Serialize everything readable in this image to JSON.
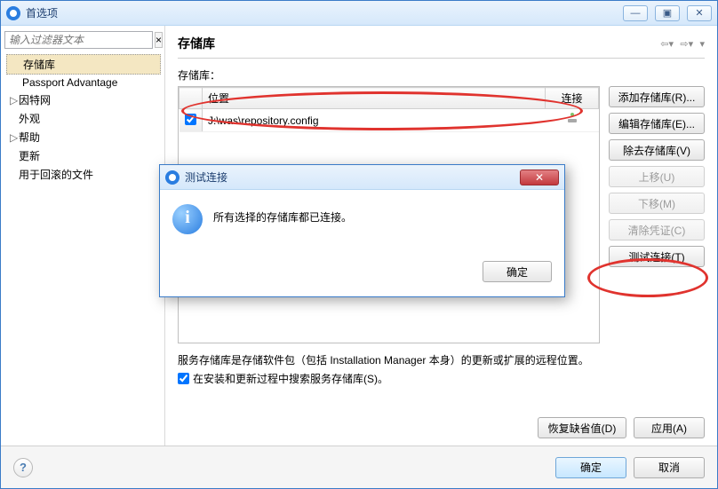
{
  "window": {
    "title": "首选项",
    "controls": {
      "min": "—",
      "max": "▣",
      "close": "✕"
    }
  },
  "sidebar": {
    "filter_placeholder": "输入过滤器文本",
    "clear_icon": "×",
    "items": [
      {
        "label": "存储库",
        "selected": true,
        "indent": 1
      },
      {
        "label": "Passport Advantage",
        "indent": 1
      },
      {
        "label": "因特网",
        "indent": 0,
        "expandable": true
      },
      {
        "label": "外观",
        "indent": 0
      },
      {
        "label": "帮助",
        "indent": 0,
        "expandable": true
      },
      {
        "label": "更新",
        "indent": 0
      },
      {
        "label": "用于回滚的文件",
        "indent": 0
      }
    ]
  },
  "main": {
    "title": "存储库",
    "section_label": "存储库：",
    "table": {
      "col_location": "位置",
      "col_connection": "连接",
      "rows": [
        {
          "checked": true,
          "location": "J:\\was\\repository.config",
          "connection_ok": true
        }
      ]
    },
    "buttons": {
      "add": "添加存储库(R)...",
      "edit": "编辑存储库(E)...",
      "remove": "除去存储库(V)",
      "up": "上移(U)",
      "down": "下移(M)",
      "clear_creds": "清除凭证(C)",
      "test": "测试连接(T)"
    },
    "desc_line1": "服务存储库是存储软件包（包括 Installation Manager 本身）的更新或扩展的远程位置。",
    "desc_checkbox_label": "在安装和更新过程中搜索服务存储库(S)。",
    "restore_defaults": "恢复缺省值(D)",
    "apply": "应用(A)"
  },
  "footer": {
    "help": "?",
    "ok": "确定",
    "cancel": "取消"
  },
  "dialog": {
    "title": "测试连接",
    "message": "所有选择的存储库都已连接。",
    "ok": "确定",
    "close": "✕"
  }
}
